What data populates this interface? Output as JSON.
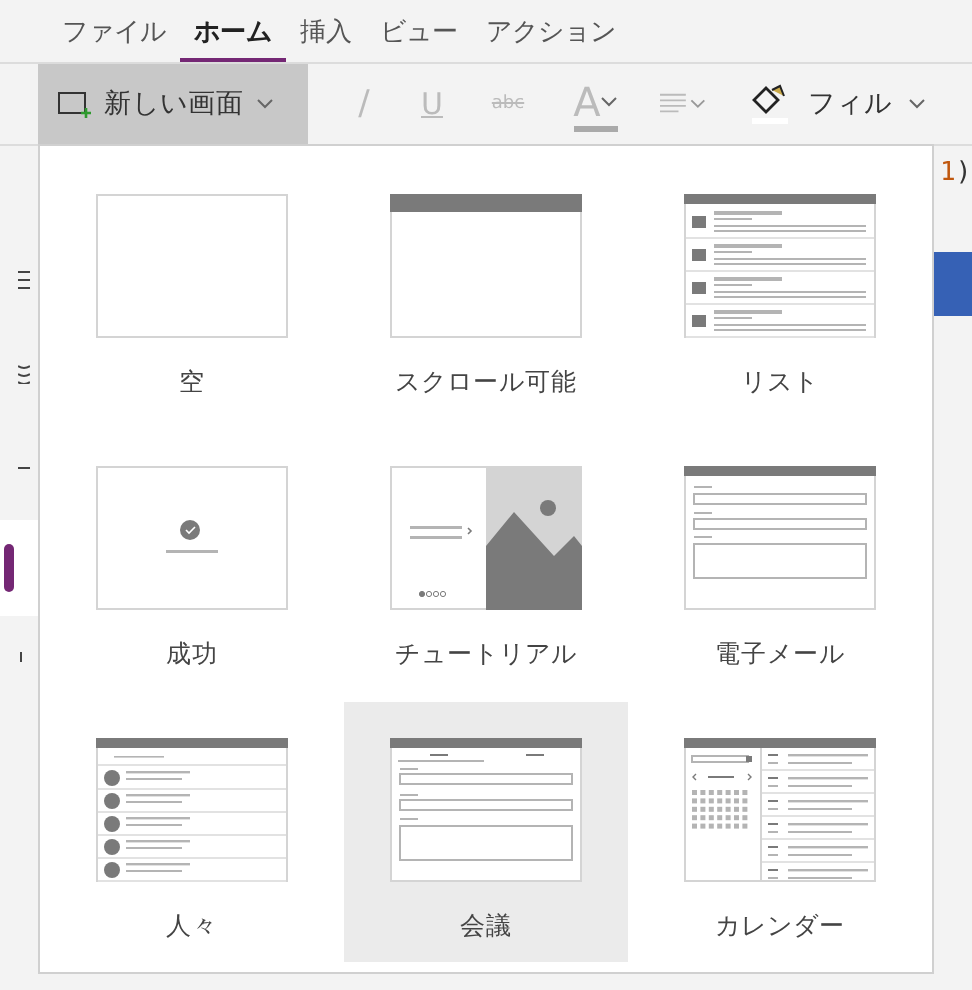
{
  "menu_tabs": [
    {
      "label": "ファイル",
      "selected": false
    },
    {
      "label": "ホーム",
      "selected": true
    },
    {
      "label": "挿入",
      "selected": false
    },
    {
      "label": "ビュー",
      "selected": false
    },
    {
      "label": "アクション",
      "selected": false
    }
  ],
  "toolbar": {
    "new_screen": {
      "label": "新しい画面",
      "expanded": true
    },
    "tools": [
      {
        "kind": "italic",
        "glyph": "/",
        "disabled": true
      },
      {
        "kind": "underline",
        "glyph": "U",
        "disabled": true
      },
      {
        "kind": "strikethrough",
        "glyph": "abc",
        "disabled": true
      },
      {
        "kind": "font_color",
        "glyph": "A",
        "disabled": true
      },
      {
        "kind": "align",
        "disabled": true
      }
    ],
    "fill": {
      "label": "フィル"
    }
  },
  "formula_fragment": {
    "number": "1",
    "paren": ")"
  },
  "screen_templates": [
    {
      "label": "空",
      "kind": "blank",
      "selected": false
    },
    {
      "label": "スクロール可能",
      "kind": "scrollable",
      "selected": false
    },
    {
      "label": "リスト",
      "kind": "list",
      "selected": false
    },
    {
      "label": "成功",
      "kind": "success",
      "selected": false
    },
    {
      "label": "チュートリアル",
      "kind": "tutorial",
      "selected": false
    },
    {
      "label": "電子メール",
      "kind": "email",
      "selected": false
    },
    {
      "label": "人々",
      "kind": "people",
      "selected": false
    },
    {
      "label": "会議",
      "kind": "meeting",
      "selected": true
    },
    {
      "label": "カレンダー",
      "kind": "calendar",
      "selected": false
    }
  ]
}
